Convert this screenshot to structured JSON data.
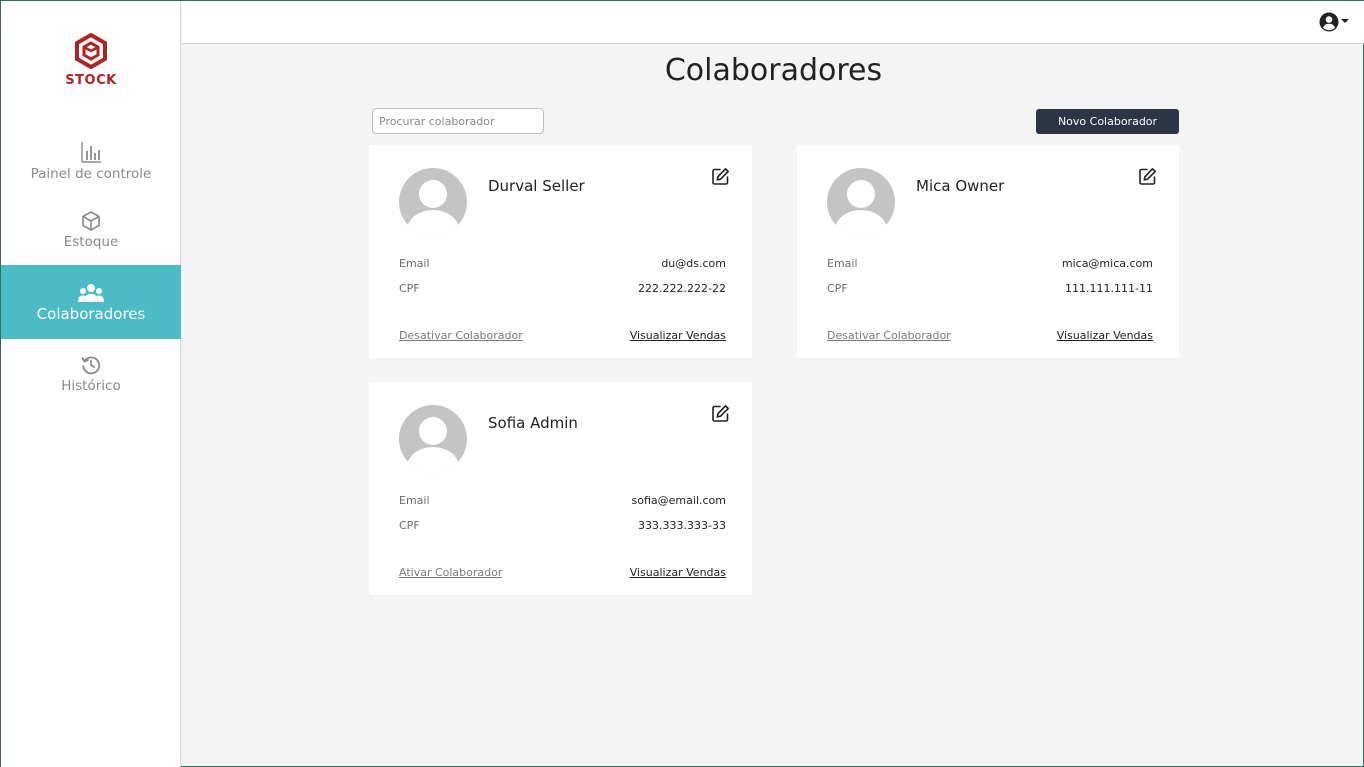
{
  "sidebar": {
    "logo_text": "STOCK",
    "brand_color": "#b22222",
    "active_color": "#4bbcc6",
    "items": [
      {
        "label": "Painel de controle",
        "icon": "bar-chart-icon"
      },
      {
        "label": "Estoque",
        "icon": "box-icon"
      },
      {
        "label": "Colaboradores",
        "icon": "users-icon",
        "active": true
      },
      {
        "label": "Histórico",
        "icon": "history-icon"
      }
    ]
  },
  "topbar": {
    "user_icon": "user-circle-icon"
  },
  "main": {
    "title": "Colaboradores",
    "search": {
      "placeholder": "Procurar colaborador",
      "value": ""
    },
    "new_button_label": "Novo Colaborador",
    "button_color": "#2d3445"
  },
  "collaborators": [
    {
      "name": "Durval Seller",
      "email_label": "Email",
      "email": "du@ds.com",
      "cpf_label": "CPF",
      "cpf": "222.222.222-22",
      "toggle_label": "Desativar Colaborador",
      "sales_label": "Visualizar Vendas"
    },
    {
      "name": "Mica Owner",
      "email_label": "Email",
      "email": "mica@mica.com",
      "cpf_label": "CPF",
      "cpf": "111.111.111-11",
      "toggle_label": "Desativar Colaborador",
      "sales_label": "Visualizar Vendas"
    },
    {
      "name": "Sofia Admin",
      "email_label": "Email",
      "email": "sofia@email.com",
      "cpf_label": "CPF",
      "cpf": "333.333.333-33",
      "toggle_label": "Ativar Colaborador",
      "sales_label": "Visualizar Vendas"
    }
  ]
}
